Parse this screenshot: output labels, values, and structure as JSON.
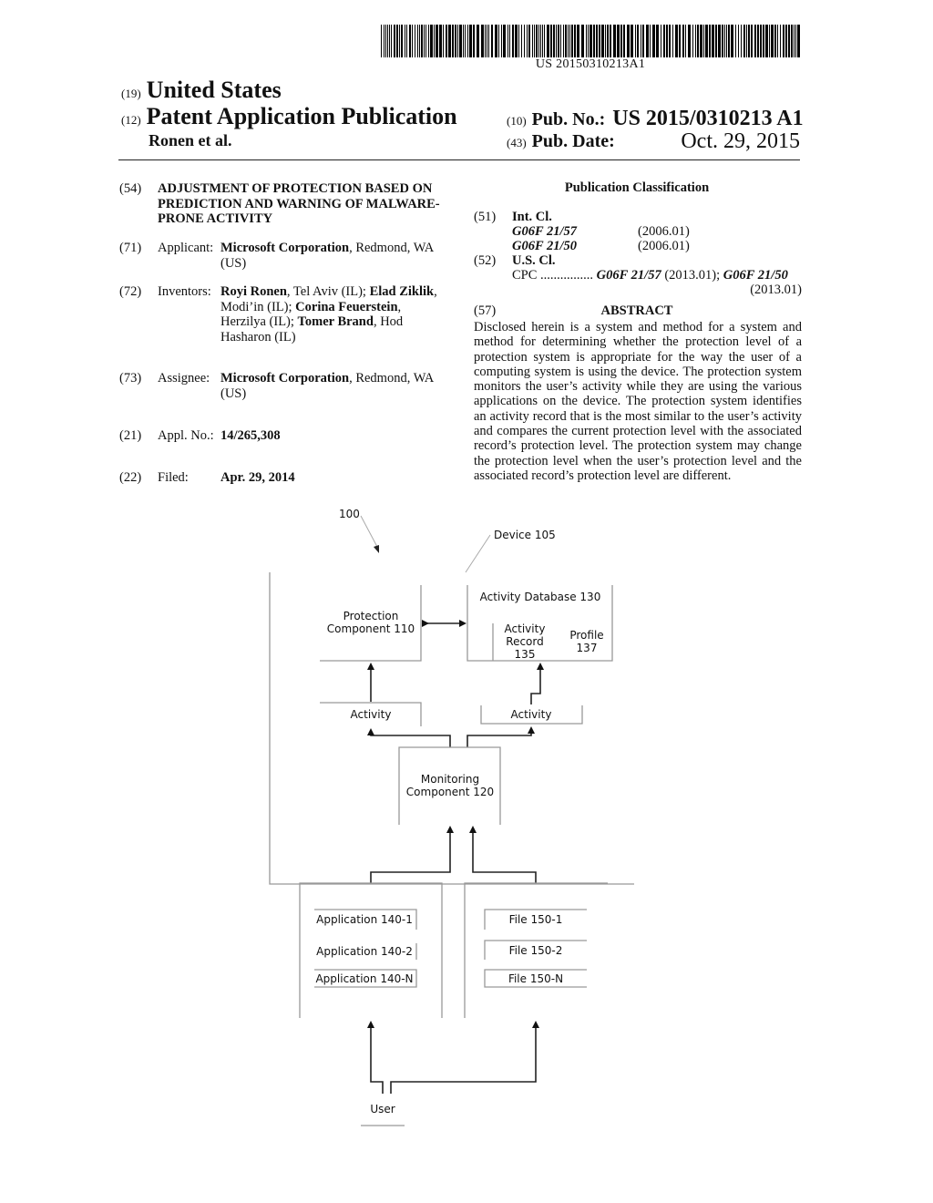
{
  "header": {
    "barcode_text": "US 20150310213A1",
    "country_code": "(19)",
    "country": "United States",
    "type_code": "(12)",
    "type": "Patent Application Publication",
    "inventor_short": "Ronen et al.",
    "pub_no_code": "(10)",
    "pub_no_label": "Pub. No.:",
    "pub_no": "US 2015/0310213 A1",
    "pub_date_code": "(43)",
    "pub_date_label": "Pub. Date:",
    "pub_date": "Oct. 29, 2015"
  },
  "left": {
    "title_code": "(54)",
    "title": "ADJUSTMENT OF PROTECTION BASED ON PREDICTION AND WARNING OF MALWARE-PRONE ACTIVITY",
    "applicant_code": "(71)",
    "applicant_label": "Applicant:",
    "applicant_name": "Microsoft Corporation",
    "applicant_loc": ", Redmond, WA (US)",
    "inventors_code": "(72)",
    "inventors_label": "Inventors:",
    "inventors": [
      {
        "name": "Royi Ronen",
        "loc": ", Tel Aviv (IL); "
      },
      {
        "name": "Elad Ziklik",
        "loc": ", Modi’in (IL); "
      },
      {
        "name": "Corina Feuerstein",
        "loc": ", Herzilya (IL); "
      },
      {
        "name": "Tomer Brand",
        "loc": ", Hod Hasharon (IL)"
      }
    ],
    "assignee_code": "(73)",
    "assignee_label": "Assignee:",
    "assignee_name": "Microsoft Corporation",
    "assignee_loc": ", Redmond, WA (US)",
    "appl_code": "(21)",
    "appl_label": "Appl. No.:",
    "appl_no": "14/265,308",
    "filed_code": "(22)",
    "filed_label": "Filed:",
    "filed_date": "Apr. 29, 2014"
  },
  "classification": {
    "title": "Publication Classification",
    "int_code": "(51)",
    "int_label": "Int. Cl.",
    "int_entries": [
      {
        "cls": "G06F 21/57",
        "ver": "(2006.01)"
      },
      {
        "cls": "G06F 21/50",
        "ver": "(2006.01)"
      }
    ],
    "us_code": "(52)",
    "us_label": "U.S. Cl.",
    "cpc_label": "CPC",
    "cpc_dots": "................",
    "cpc_1": "G06F 21/57",
    "cpc_1_ver": " (2013.01); ",
    "cpc_2": "G06F 21/50",
    "cpc_2_ver": "(2013.01)"
  },
  "abstract": {
    "code": "(57)",
    "title": "ABSTRACT",
    "text": "Disclosed herein is a system and method for a system and method for determining whether the protection level of a protection system is appropriate for the way the user of a computing system is using the device. The protection system monitors the user’s activity while they are using the various applications on the device. The protection system identifies an activity record that is the most similar to the user’s activity and compares the current protection level with the associated record’s protection level. The protection system may change the protection level when the user’s protection level and the associated record’s protection level are different."
  },
  "diagram": {
    "ref_system": "100",
    "device": "Device 105",
    "protection_1": "Protection",
    "protection_2": "Component 110",
    "database": "Activity Database 130",
    "record_1": "Activity",
    "record_2": "Record",
    "record_3": "135",
    "profile_1": "Profile",
    "profile_2": "137",
    "activity_left": "Activity",
    "activity_right": "Activity",
    "monitoring_1": "Monitoring",
    "monitoring_2": "Component 120",
    "applications": [
      "Application 140-1",
      "Application 140-2",
      "Application 140-N"
    ],
    "files": [
      "File 150-1",
      "File 150-2",
      "File 150-N"
    ],
    "user": "User"
  }
}
